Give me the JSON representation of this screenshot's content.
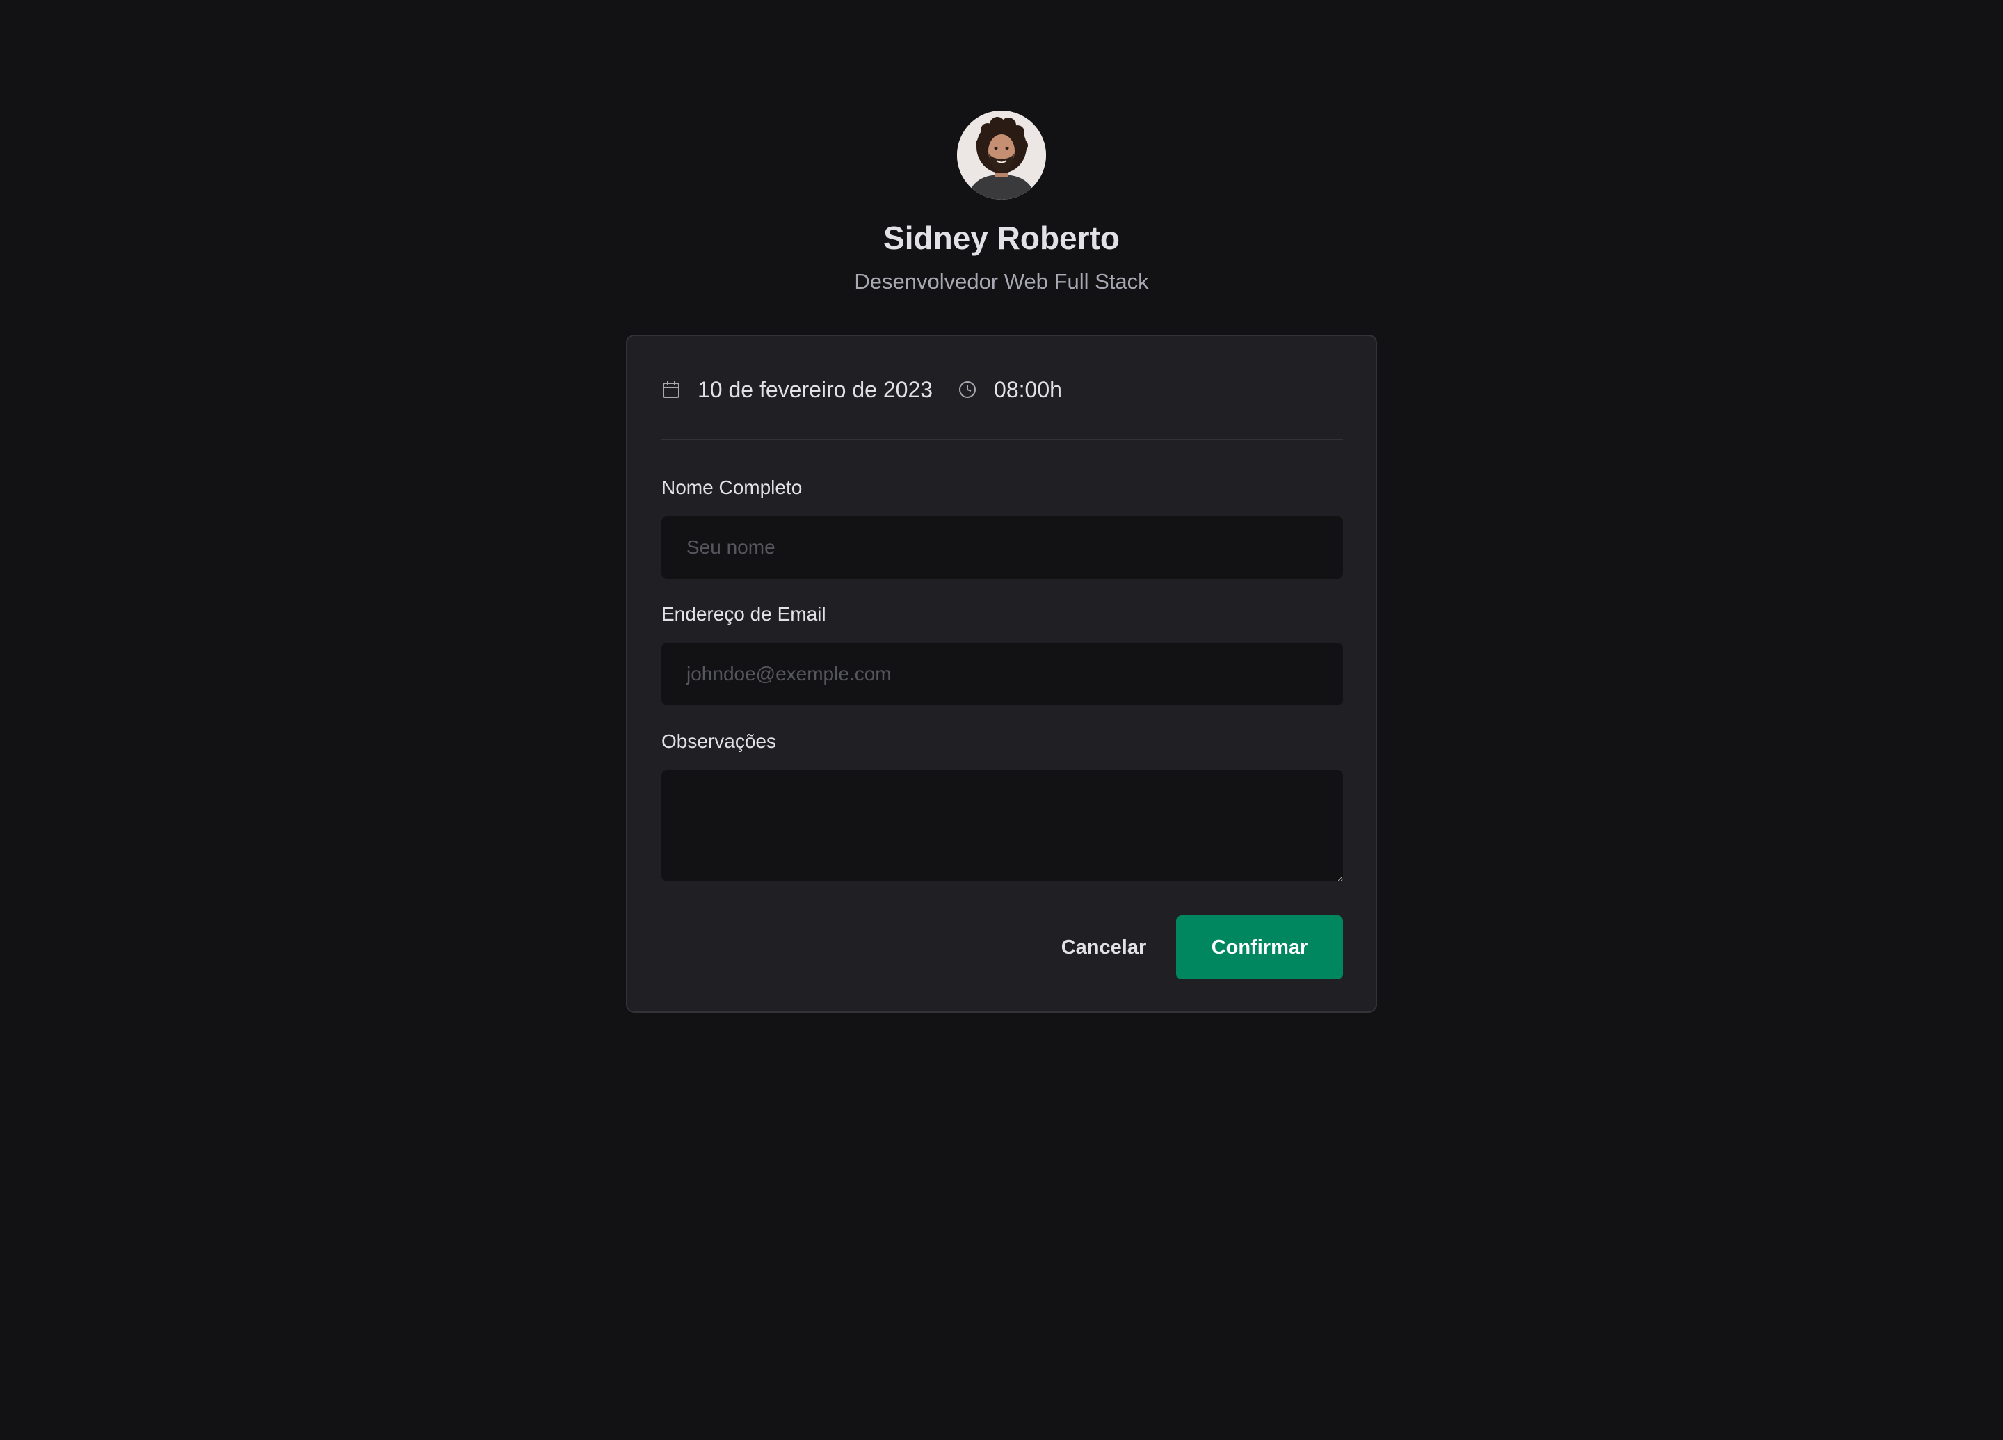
{
  "profile": {
    "name": "Sidney Roberto",
    "role": "Desenvolvedor Web Full Stack",
    "avatar_icon": "user-avatar-photo"
  },
  "schedule": {
    "date_icon": "calendar-icon",
    "date": "10 de fevereiro de 2023",
    "time_icon": "clock-icon",
    "time": "08:00h"
  },
  "form": {
    "name_label": "Nome Completo",
    "name_placeholder": "Seu nome",
    "name_value": "",
    "email_label": "Endereço de Email",
    "email_placeholder": "johndoe@exemple.com",
    "email_value": "",
    "notes_label": "Observações",
    "notes_value": ""
  },
  "actions": {
    "cancel_label": "Cancelar",
    "confirm_label": "Confirmar"
  },
  "colors": {
    "background": "#121214",
    "card": "#202024",
    "border": "#323238",
    "accent": "#00875f",
    "text": "#e1e1e6",
    "muted": "#a8a8b3"
  }
}
